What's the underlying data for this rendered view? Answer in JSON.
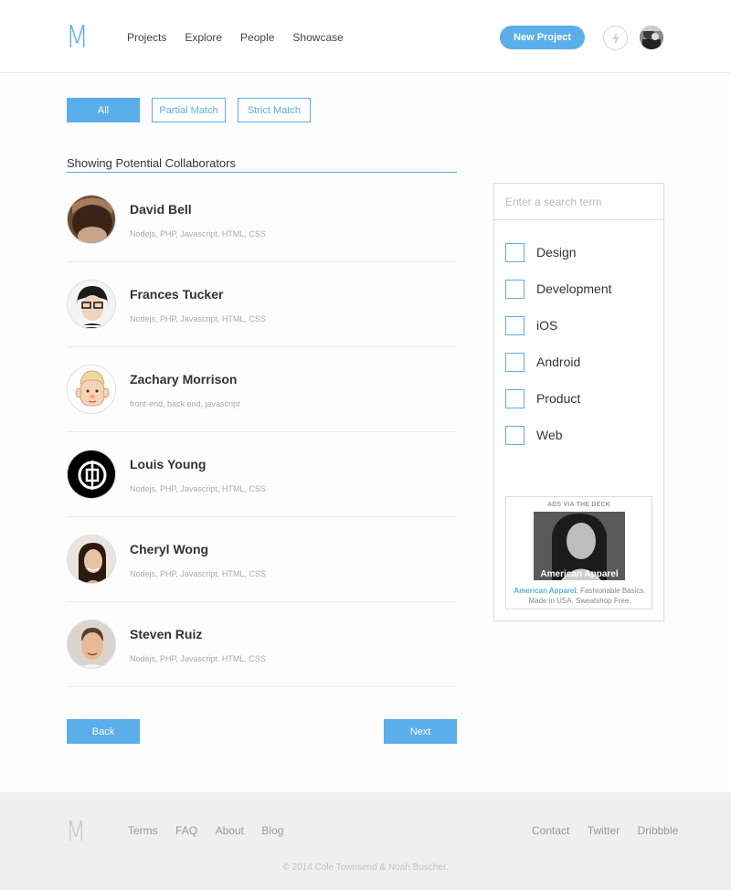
{
  "header": {
    "logo": "M",
    "nav": [
      "Projects",
      "Explore",
      "People",
      "Showcase"
    ],
    "new_project_label": "New Project"
  },
  "filters": {
    "all": "All",
    "partial": "Partial Match",
    "strict": "Strict Match",
    "selected": "All"
  },
  "main": {
    "title": "Showing Potential Collaborators",
    "people": [
      {
        "name": "David Bell",
        "tags": "Nodejs, PHP, Javascript, HTML, CSS"
      },
      {
        "name": "Frances Tucker",
        "tags": "Nodejs, PHP, Javascript, HTML, CSS"
      },
      {
        "name": "Zachary Morrison",
        "tags": "front-end, back end, javascript"
      },
      {
        "name": "Louis Young",
        "tags": "Nodejs, PHP, Javascript, HTML, CSS"
      },
      {
        "name": "Cheryl Wong",
        "tags": "Nodejs, PHP, Javascript, HTML, CSS"
      },
      {
        "name": "Steven Ruiz",
        "tags": "Nodejs, PHP, Javascript, HTML, CSS"
      }
    ],
    "back_label": "Back",
    "next_label": "Next"
  },
  "sidebar": {
    "search_placeholder": "Enter a search term",
    "categories": [
      "Design",
      "Development",
      "iOS",
      "Android",
      "Product",
      "Web"
    ],
    "ad": {
      "heading": "ADS VIA THE DECK",
      "image_text": "American Apparel",
      "brand": "American Apparel",
      "text": ": Fashionable Basics. Made in USA. Sweatshop Free."
    }
  },
  "footer": {
    "logo": "M",
    "left_links": [
      "Terms",
      "FAQ",
      "About",
      "Blog"
    ],
    "right_links": [
      "Contact",
      "Twitter",
      "Dribbble"
    ],
    "copyright": "© 2014 Cole Townsend & Noah Buscher."
  },
  "colors": {
    "accent": "#5aaeea",
    "footer_bg": "#efefef"
  }
}
